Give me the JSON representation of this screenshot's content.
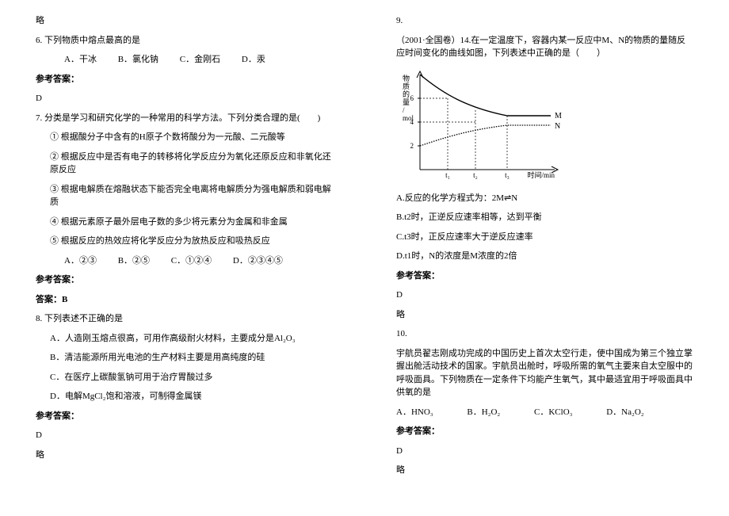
{
  "left": {
    "略": "略",
    "q6": {
      "stem": "6. 下列物质中熔点最高的是",
      "opts": {
        "a": "A．干冰",
        "b": "B．氯化钠",
        "c": "C．金刚石",
        "d": "D．汞"
      },
      "ansLabel": "参考答案：",
      "ans": "D"
    },
    "q7": {
      "stem": "7. 分类是学习和研究化学的一种常用的科学方法。下列分类合理的是(　　)",
      "i1": "①  根据酸分子中含有的H原子个数将酸分为一元酸、二元酸等",
      "i2": "②  根据反应中是否有电子的转移将化学反应分为氧化还原反应和非氧化还原反应",
      "i3": "③  根据电解质在熔融状态下能否完全电离将电解质分为强电解质和弱电解质",
      "i4": "④  根据元素原子最外层电子数的多少将元素分为金属和非金属",
      "i5": "⑤  根据反应的热效应将化学反应分为放热反应和吸热反应",
      "opts": {
        "a": "A．②③",
        "b": "B．②⑤",
        "c": "C．①②④",
        "d": "D．②③④⑤"
      },
      "ansLabel": "参考答案：",
      "ans": "答案：B"
    },
    "q8": {
      "stem": "8. 下列表述不正确的是",
      "a": "A．人造刚玉熔点很高，可用作高级耐火材料，主要成分是Al₂O₃",
      "b": "B．清洁能源所用光电池的生产材料主要是用高纯度的硅",
      "c": "C．在医疗上碳酸氢钠可用于治疗胃酸过多",
      "d": "D．电解MgCl₂饱和溶液，可制得金属镁",
      "ansLabel": "参考答案：",
      "ans": "D",
      "略": "略"
    }
  },
  "right": {
    "q9": {
      "num": "9.",
      "stem": "（2001·全国卷）14.在一定温度下，容器内某一反应中M、N的物质的量随反应时间变化的曲线如图，下列表述中正确的是（　　）",
      "chart": {
        "ylab_lines": [
          "物",
          "质",
          "的",
          "量",
          "/",
          "mol"
        ],
        "yticks": [
          "2",
          "4",
          "6"
        ],
        "xlab": "时间/min",
        "xticks": [
          "t₁",
          "t₂",
          "t₃"
        ],
        "legend": {
          "m": "M",
          "n": "N"
        }
      },
      "optA": "A.反应的化学方程式为：2M⇌N",
      "optB": "B.t2时，正逆反应速率相等，达到平衡",
      "optC": "C.t3时，正反应速率大于逆反应速率",
      "optD": "D.t1时，N的浓度是M浓度的2倍",
      "ansLabel": "参考答案：",
      "ans": "D",
      "略": "略"
    },
    "q10": {
      "num": "10.",
      "stem": "宇航员翟志刚成功完成的中国历史上首次太空行走，使中国成为第三个独立掌握出舱活动技术的国家。宇航员出舱时，呼吸所需的氧气主要来自太空服中的呼吸面具。下列物质在一定条件下均能产生氧气，其中最适宜用于呼吸面具中供氧的是",
      "opts": {
        "a": "A．HNO₃",
        "b": "B．H₂O₂",
        "c": "C．KClO₃",
        "d": "D．Na₂O₂"
      },
      "ansLabel": "参考答案：",
      "ans": "D",
      "略": "略"
    }
  },
  "chart_data": {
    "type": "line",
    "title": "",
    "xlabel": "时间/min",
    "ylabel": "物质的量/mol",
    "ylim": [
      0,
      8
    ],
    "xticks": [
      "t1",
      "t2",
      "t3"
    ],
    "series": [
      {
        "name": "M",
        "x": [
          0,
          "t1",
          "t2",
          "t3",
          "end"
        ],
        "values": [
          8,
          6,
          5,
          4.5,
          4.5
        ]
      },
      {
        "name": "N",
        "x": [
          0,
          "t1",
          "t2",
          "t3",
          "end"
        ],
        "values": [
          2,
          3,
          3.5,
          3.75,
          3.75
        ]
      }
    ]
  }
}
